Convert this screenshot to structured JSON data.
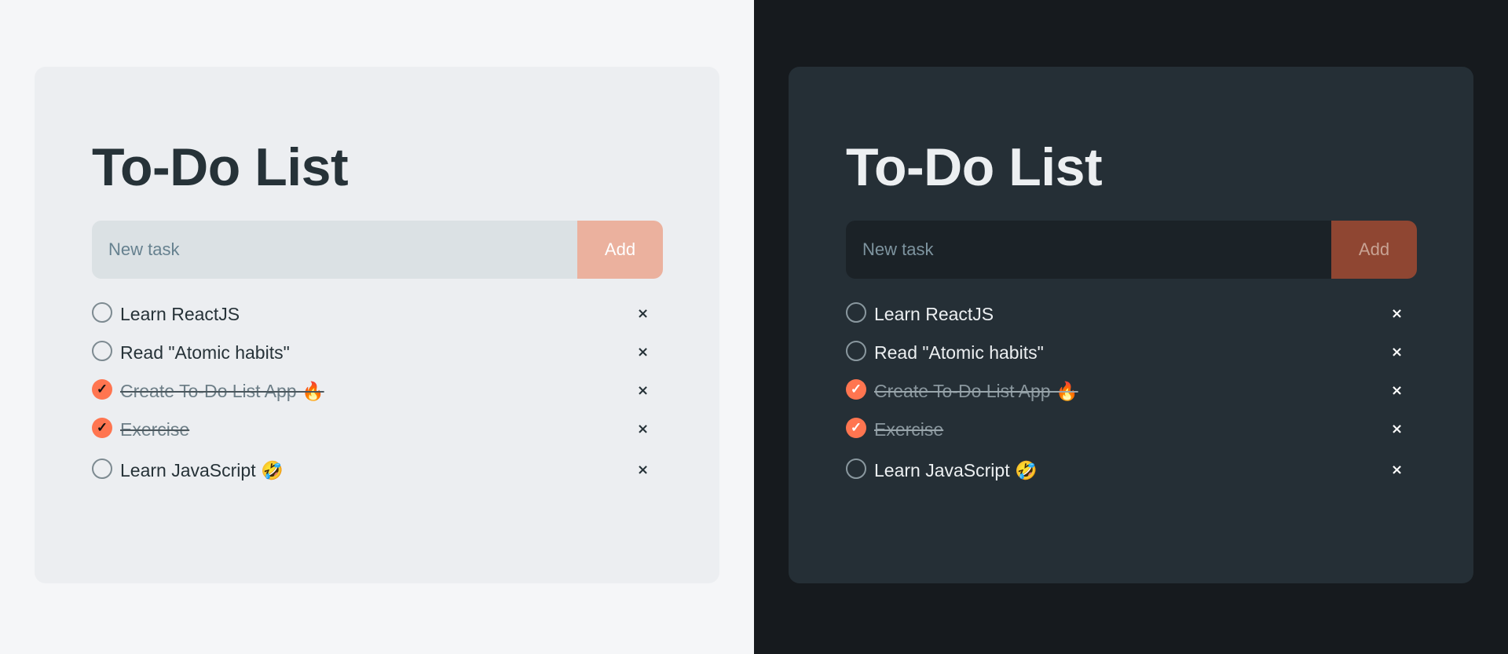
{
  "title": "To-Do List",
  "input": {
    "placeholder": "New task"
  },
  "add_label": "Add",
  "delete_glyph": "×",
  "check_glyph": "✓",
  "accent": "#ff7550",
  "tasks": [
    {
      "text": "Learn ReactJS",
      "done": false
    },
    {
      "text": "Read \"Atomic habits\"",
      "done": false
    },
    {
      "text": "Create To-Do List App 🔥",
      "done": true
    },
    {
      "text": "Exercise",
      "done": true
    },
    {
      "text": "Learn JavaScript 🤣",
      "done": false
    }
  ]
}
